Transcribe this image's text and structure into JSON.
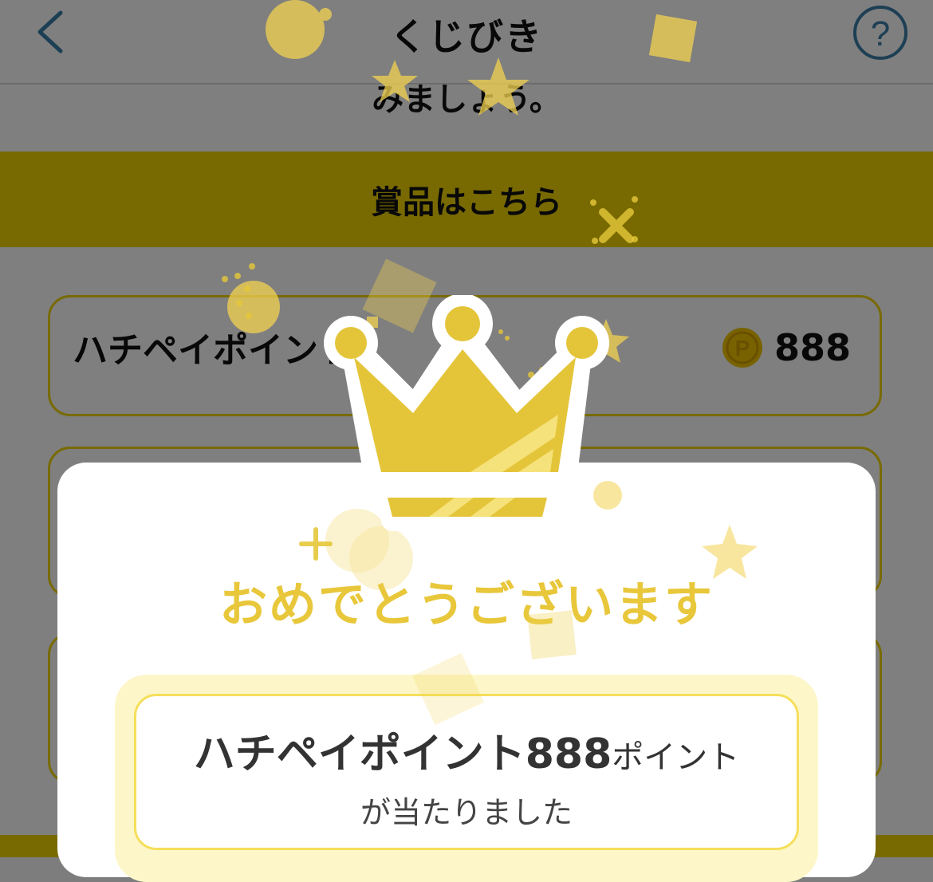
{
  "header": {
    "title": "くじびき",
    "back_icon": "chevron-left-icon",
    "help_icon": "question-circle-icon",
    "accent_color": "#3a7ea8"
  },
  "intro": {
    "text": "みましょう。"
  },
  "prizes": {
    "banner_label": "賞品はこちら",
    "items": [
      {
        "name": "ハチペイポイント",
        "points": "888",
        "coin_icon": "point-coin-icon"
      }
    ]
  },
  "modal": {
    "congrats": "おめでとうございます",
    "result_name": "ハチペイポイント888",
    "result_unit": "ポイント",
    "result_suffix": "が当たりました",
    "crown_icon": "crown-icon"
  },
  "colors": {
    "brand_yellow": "#f0d400",
    "congrats_yellow": "#e8c73b",
    "overlay": "rgba(0,0,0,0.5)"
  }
}
